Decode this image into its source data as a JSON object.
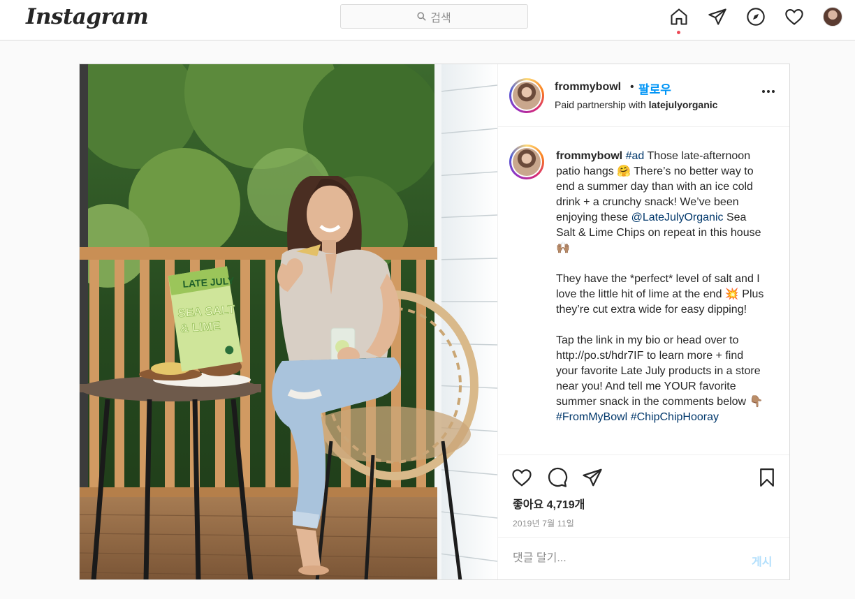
{
  "header": {
    "logo_text": "Instagram",
    "search_placeholder": "검색",
    "icons": [
      "home-icon",
      "direct-message-icon",
      "explore-compass-icon",
      "activity-heart-icon",
      "profile-avatar"
    ]
  },
  "post": {
    "username": "frommybowl",
    "separator": "•",
    "follow_label": "팔로우",
    "partnership_prefix": "Paid partnership with ",
    "partner": "latejulyorganic",
    "caption": {
      "username": "frommybowl",
      "hashtag_ad": "#ad",
      "text1": " Those late-afternoon patio hangs 🤗 There’s no better way to end a summer day than with an ice cold drink + a crunchy snack! We’ve been enjoying these ",
      "mention": "@LateJulyOrganic",
      "text2": " Sea Salt & Lime Chips on repeat in this house 🙌🏽",
      "paragraph2": "They have the *perfect* level of salt and I love the little hit of lime at the end 💥 Plus they’re cut extra wide for easy dipping!",
      "paragraph3": "Tap the link in my bio or head over to http://po.st/hdr7IF to learn more + find your favorite Late July products in a store near you! And tell me YOUR favorite summer snack in the comments below 👇🏽 ",
      "hashtag1": "#FromMyBowl",
      "hashtag2": "#ChipChipHooray"
    },
    "likes": "좋아요 4,719개",
    "date": "2019년 7월 11일",
    "comment_placeholder": "댓글 달기...",
    "post_button": "게시",
    "photo": {
      "bag_brand": "LATE JULY",
      "bag_flavor_1": "SEA SALT",
      "bag_flavor_2": "& LIME"
    }
  },
  "colors": {
    "accent_blue": "#0095f6",
    "link_blue": "#00376b",
    "border": "#dbdbdb",
    "notification_red": "#ed4956"
  }
}
